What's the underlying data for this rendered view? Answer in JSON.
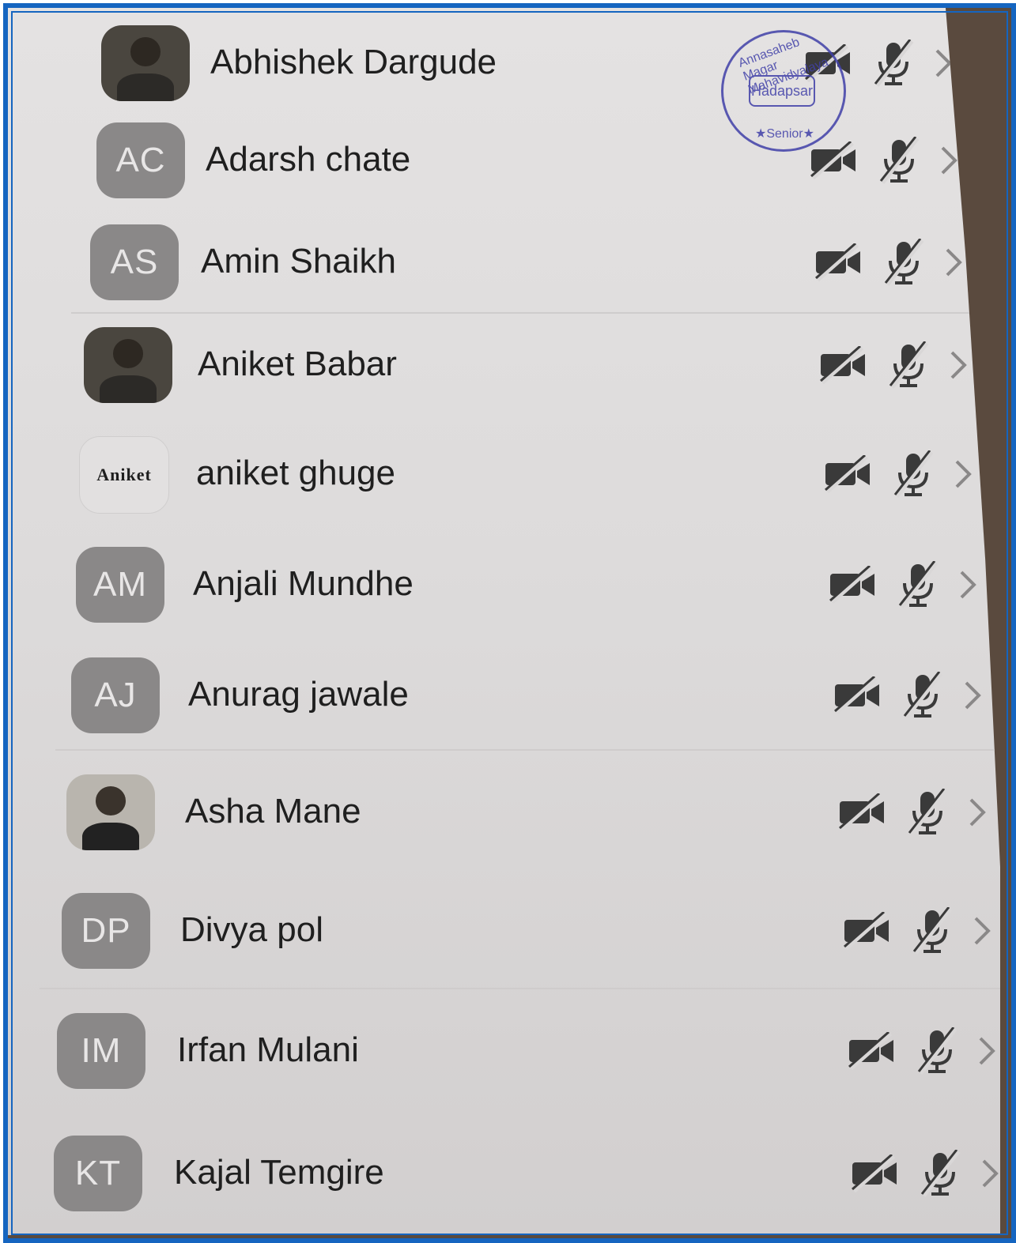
{
  "participants": [
    {
      "name": "Abhishek Dargude",
      "avatar_type": "photo",
      "initials": ""
    },
    {
      "name": "Adarsh chate",
      "avatar_type": "initials",
      "initials": "AC"
    },
    {
      "name": "Amin Shaikh",
      "avatar_type": "initials",
      "initials": "AS"
    },
    {
      "name": "Aniket Babar",
      "avatar_type": "photo",
      "initials": ""
    },
    {
      "name": "aniket ghuge",
      "avatar_type": "logo",
      "initials": "Aniket"
    },
    {
      "name": "Anjali Mundhe",
      "avatar_type": "initials",
      "initials": "AM"
    },
    {
      "name": "Anurag jawale",
      "avatar_type": "initials",
      "initials": "AJ"
    },
    {
      "name": "Asha Mane",
      "avatar_type": "photo",
      "initials": ""
    },
    {
      "name": "Divya pol",
      "avatar_type": "initials",
      "initials": "DP"
    },
    {
      "name": "Irfan Mulani",
      "avatar_type": "initials",
      "initials": "IM"
    },
    {
      "name": "Kajal Temgire",
      "avatar_type": "initials",
      "initials": "KT"
    }
  ],
  "stamp": {
    "center": "Hadapsar",
    "ring_top": "Annasaheb Magar Mahavidyalaya",
    "ring_bottom": "★Senior★"
  },
  "icons": {
    "video": "video-off-icon",
    "mic": "mic-off-icon",
    "chevron": "chevron-right-icon"
  },
  "colors": {
    "frame": "#1565c0",
    "avatar_bg": "#8a8888",
    "icon": "#3a3a3a",
    "stamp": "#4040a8"
  }
}
